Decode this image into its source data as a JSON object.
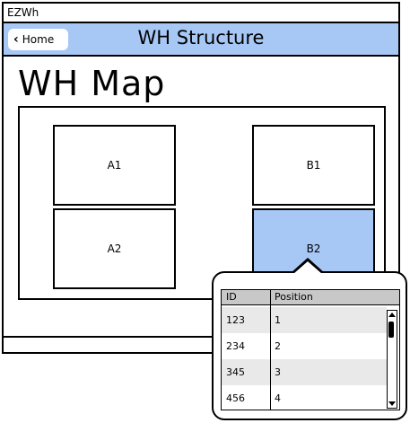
{
  "window": {
    "title": "EZWh"
  },
  "header": {
    "home_label": "Home",
    "title": "WH Structure"
  },
  "page": {
    "title": "WH Map"
  },
  "map": {
    "zones": [
      {
        "id": "A1",
        "selected": false
      },
      {
        "id": "B1",
        "selected": false
      },
      {
        "id": "A2",
        "selected": false
      },
      {
        "id": "B2",
        "selected": true
      }
    ]
  },
  "popover": {
    "columns": [
      "ID",
      "Position"
    ],
    "rows": [
      {
        "id": "123",
        "position": "1"
      },
      {
        "id": "234",
        "position": "2"
      },
      {
        "id": "345",
        "position": "3"
      },
      {
        "id": "456",
        "position": "4"
      }
    ]
  },
  "colors": {
    "accent": "#a7c7f5",
    "header_row": "#c8c8c8",
    "alt_row": "#e9e9e9"
  }
}
